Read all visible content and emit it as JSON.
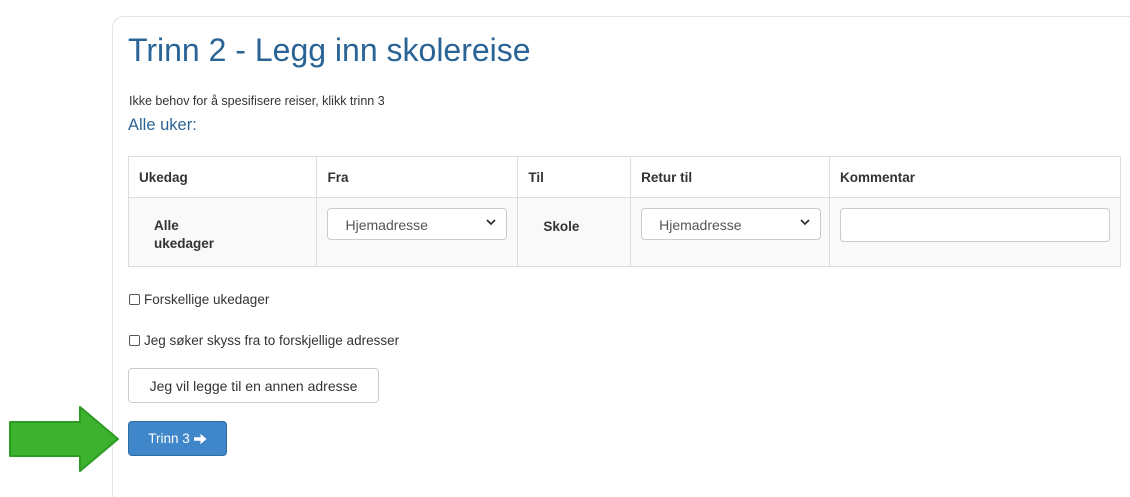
{
  "title": "Trinn 2 - Legg inn skolereise",
  "hint": "Ikke behov for å spesifisere reiser, klikk trinn 3",
  "subheading": "Alle uker:",
  "table": {
    "headers": [
      "Ukedag",
      "Fra",
      "Til",
      "Retur til",
      "Kommentar"
    ],
    "row": {
      "day_line1": "Alle",
      "day_line2": "ukedager",
      "from_value": "Hjemadresse",
      "to_value": "Skole",
      "return_value": "Hjemadresse",
      "comment_value": ""
    }
  },
  "checkboxes": {
    "different_weekdays": "Forskellige ukedager",
    "two_addresses": "Jeg søker skyss fra to forskjellige adresser"
  },
  "buttons": {
    "add_address": "Jeg vil legge til en annen adresse",
    "next_step": "Trinn 3"
  },
  "icons": {
    "select_chevron": "chevron-down-icon",
    "next_arrow": "arrow-right-icon",
    "callout_arrow": "green-arrow-icon"
  },
  "colors": {
    "heading": "#2a6496",
    "primary_button": "#3f87c9",
    "callout_arrow": "#3cb22f"
  }
}
